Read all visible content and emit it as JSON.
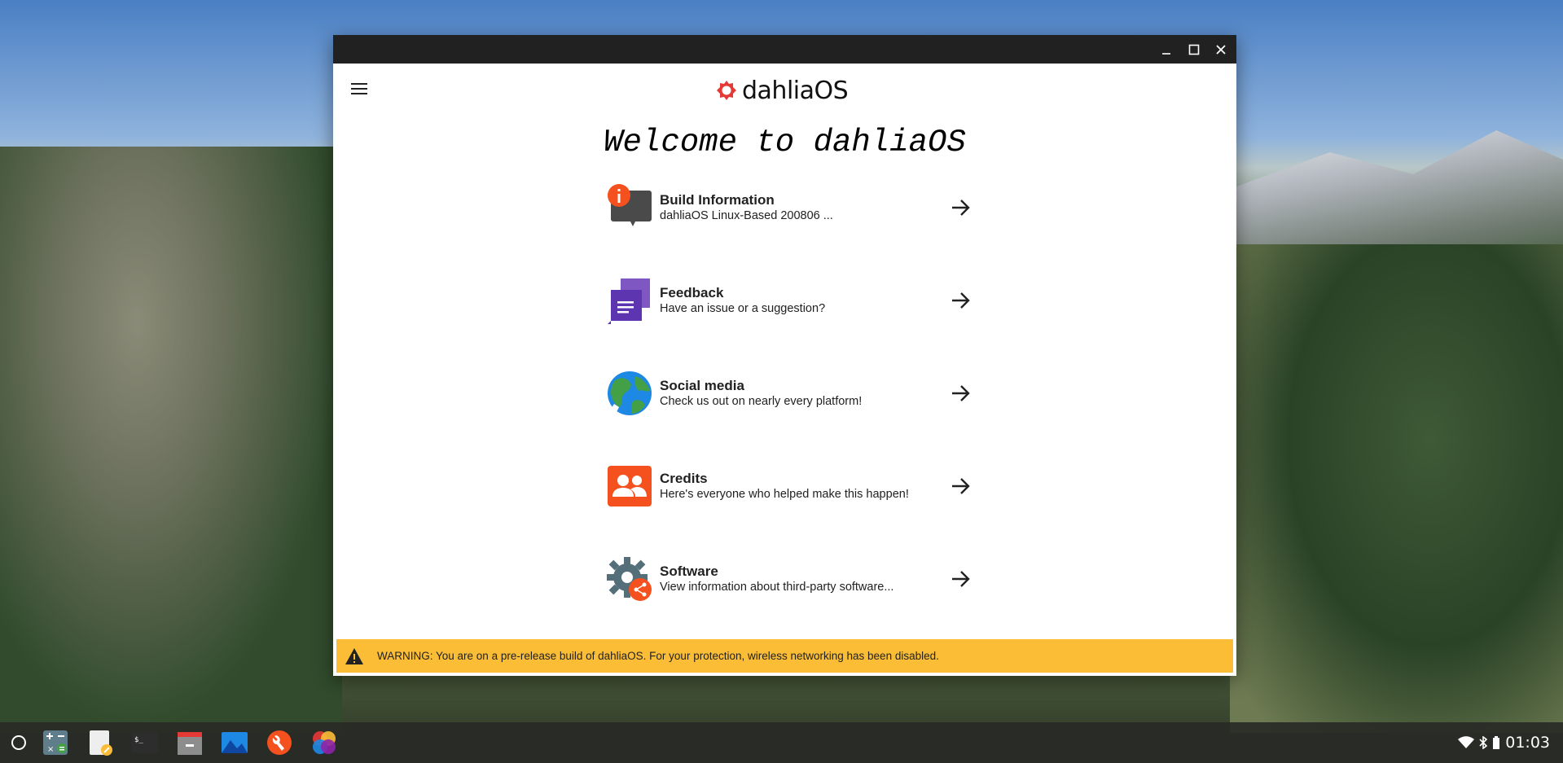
{
  "window": {
    "minimize_icon": "minimize-icon",
    "maximize_icon": "maximize-icon",
    "close_icon": "close-icon"
  },
  "header": {
    "menu_icon": "hamburger-menu-icon",
    "logo_text": "dahliaOS"
  },
  "welcome_title": "Welcome to dahliaOS",
  "items": [
    {
      "title": "Build Information",
      "subtitle": "dahliaOS Linux-Based 200806 ...",
      "icon": "build-info-icon"
    },
    {
      "title": "Feedback",
      "subtitle": "Have an issue or a suggestion?",
      "icon": "feedback-icon"
    },
    {
      "title": "Social media",
      "subtitle": "Check us out on nearly every platform!",
      "icon": "globe-icon"
    },
    {
      "title": "Credits",
      "subtitle": "Here's everyone who helped make this happen!",
      "icon": "people-icon"
    },
    {
      "title": "Software",
      "subtitle": "View information about third-party software...",
      "icon": "gear-share-icon"
    }
  ],
  "warning": {
    "text": "WARNING: You are on a pre-release build of dahliaOS. For your protection, wireless networking has been disabled.",
    "icon": "warning-icon"
  },
  "taskbar": {
    "apps": [
      "launcher-icon",
      "calculator-icon",
      "text-editor-icon",
      "terminal-icon",
      "files-icon",
      "media-icon",
      "settings-icon",
      "graft-icon"
    ],
    "clock": "01:03"
  },
  "colors": {
    "titlebar": "#212121",
    "warning": "#fbbd36",
    "accent_red": "#e53935",
    "accent_purple": "#673ab7",
    "accent_orange": "#f4511e"
  }
}
